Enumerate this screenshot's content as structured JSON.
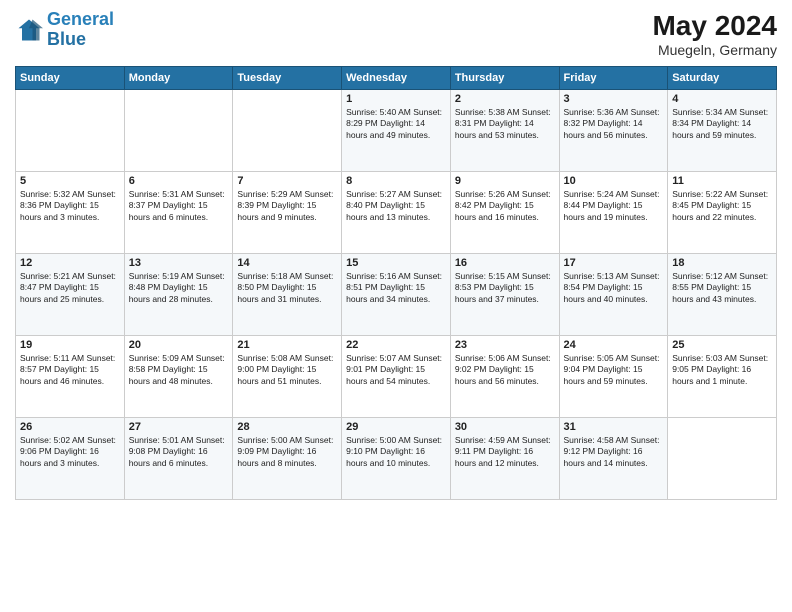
{
  "header": {
    "logo_line1": "General",
    "logo_line2": "Blue",
    "month_year": "May 2024",
    "location": "Muegeln, Germany"
  },
  "days_of_week": [
    "Sunday",
    "Monday",
    "Tuesday",
    "Wednesday",
    "Thursday",
    "Friday",
    "Saturday"
  ],
  "weeks": [
    [
      {
        "day": "",
        "content": ""
      },
      {
        "day": "",
        "content": ""
      },
      {
        "day": "",
        "content": ""
      },
      {
        "day": "1",
        "content": "Sunrise: 5:40 AM\nSunset: 8:29 PM\nDaylight: 14 hours\nand 49 minutes."
      },
      {
        "day": "2",
        "content": "Sunrise: 5:38 AM\nSunset: 8:31 PM\nDaylight: 14 hours\nand 53 minutes."
      },
      {
        "day": "3",
        "content": "Sunrise: 5:36 AM\nSunset: 8:32 PM\nDaylight: 14 hours\nand 56 minutes."
      },
      {
        "day": "4",
        "content": "Sunrise: 5:34 AM\nSunset: 8:34 PM\nDaylight: 14 hours\nand 59 minutes."
      }
    ],
    [
      {
        "day": "5",
        "content": "Sunrise: 5:32 AM\nSunset: 8:36 PM\nDaylight: 15 hours\nand 3 minutes."
      },
      {
        "day": "6",
        "content": "Sunrise: 5:31 AM\nSunset: 8:37 PM\nDaylight: 15 hours\nand 6 minutes."
      },
      {
        "day": "7",
        "content": "Sunrise: 5:29 AM\nSunset: 8:39 PM\nDaylight: 15 hours\nand 9 minutes."
      },
      {
        "day": "8",
        "content": "Sunrise: 5:27 AM\nSunset: 8:40 PM\nDaylight: 15 hours\nand 13 minutes."
      },
      {
        "day": "9",
        "content": "Sunrise: 5:26 AM\nSunset: 8:42 PM\nDaylight: 15 hours\nand 16 minutes."
      },
      {
        "day": "10",
        "content": "Sunrise: 5:24 AM\nSunset: 8:44 PM\nDaylight: 15 hours\nand 19 minutes."
      },
      {
        "day": "11",
        "content": "Sunrise: 5:22 AM\nSunset: 8:45 PM\nDaylight: 15 hours\nand 22 minutes."
      }
    ],
    [
      {
        "day": "12",
        "content": "Sunrise: 5:21 AM\nSunset: 8:47 PM\nDaylight: 15 hours\nand 25 minutes."
      },
      {
        "day": "13",
        "content": "Sunrise: 5:19 AM\nSunset: 8:48 PM\nDaylight: 15 hours\nand 28 minutes."
      },
      {
        "day": "14",
        "content": "Sunrise: 5:18 AM\nSunset: 8:50 PM\nDaylight: 15 hours\nand 31 minutes."
      },
      {
        "day": "15",
        "content": "Sunrise: 5:16 AM\nSunset: 8:51 PM\nDaylight: 15 hours\nand 34 minutes."
      },
      {
        "day": "16",
        "content": "Sunrise: 5:15 AM\nSunset: 8:53 PM\nDaylight: 15 hours\nand 37 minutes."
      },
      {
        "day": "17",
        "content": "Sunrise: 5:13 AM\nSunset: 8:54 PM\nDaylight: 15 hours\nand 40 minutes."
      },
      {
        "day": "18",
        "content": "Sunrise: 5:12 AM\nSunset: 8:55 PM\nDaylight: 15 hours\nand 43 minutes."
      }
    ],
    [
      {
        "day": "19",
        "content": "Sunrise: 5:11 AM\nSunset: 8:57 PM\nDaylight: 15 hours\nand 46 minutes."
      },
      {
        "day": "20",
        "content": "Sunrise: 5:09 AM\nSunset: 8:58 PM\nDaylight: 15 hours\nand 48 minutes."
      },
      {
        "day": "21",
        "content": "Sunrise: 5:08 AM\nSunset: 9:00 PM\nDaylight: 15 hours\nand 51 minutes."
      },
      {
        "day": "22",
        "content": "Sunrise: 5:07 AM\nSunset: 9:01 PM\nDaylight: 15 hours\nand 54 minutes."
      },
      {
        "day": "23",
        "content": "Sunrise: 5:06 AM\nSunset: 9:02 PM\nDaylight: 15 hours\nand 56 minutes."
      },
      {
        "day": "24",
        "content": "Sunrise: 5:05 AM\nSunset: 9:04 PM\nDaylight: 15 hours\nand 59 minutes."
      },
      {
        "day": "25",
        "content": "Sunrise: 5:03 AM\nSunset: 9:05 PM\nDaylight: 16 hours\nand 1 minute."
      }
    ],
    [
      {
        "day": "26",
        "content": "Sunrise: 5:02 AM\nSunset: 9:06 PM\nDaylight: 16 hours\nand 3 minutes."
      },
      {
        "day": "27",
        "content": "Sunrise: 5:01 AM\nSunset: 9:08 PM\nDaylight: 16 hours\nand 6 minutes."
      },
      {
        "day": "28",
        "content": "Sunrise: 5:00 AM\nSunset: 9:09 PM\nDaylight: 16 hours\nand 8 minutes."
      },
      {
        "day": "29",
        "content": "Sunrise: 5:00 AM\nSunset: 9:10 PM\nDaylight: 16 hours\nand 10 minutes."
      },
      {
        "day": "30",
        "content": "Sunrise: 4:59 AM\nSunset: 9:11 PM\nDaylight: 16 hours\nand 12 minutes."
      },
      {
        "day": "31",
        "content": "Sunrise: 4:58 AM\nSunset: 9:12 PM\nDaylight: 16 hours\nand 14 minutes."
      },
      {
        "day": "",
        "content": ""
      }
    ]
  ]
}
